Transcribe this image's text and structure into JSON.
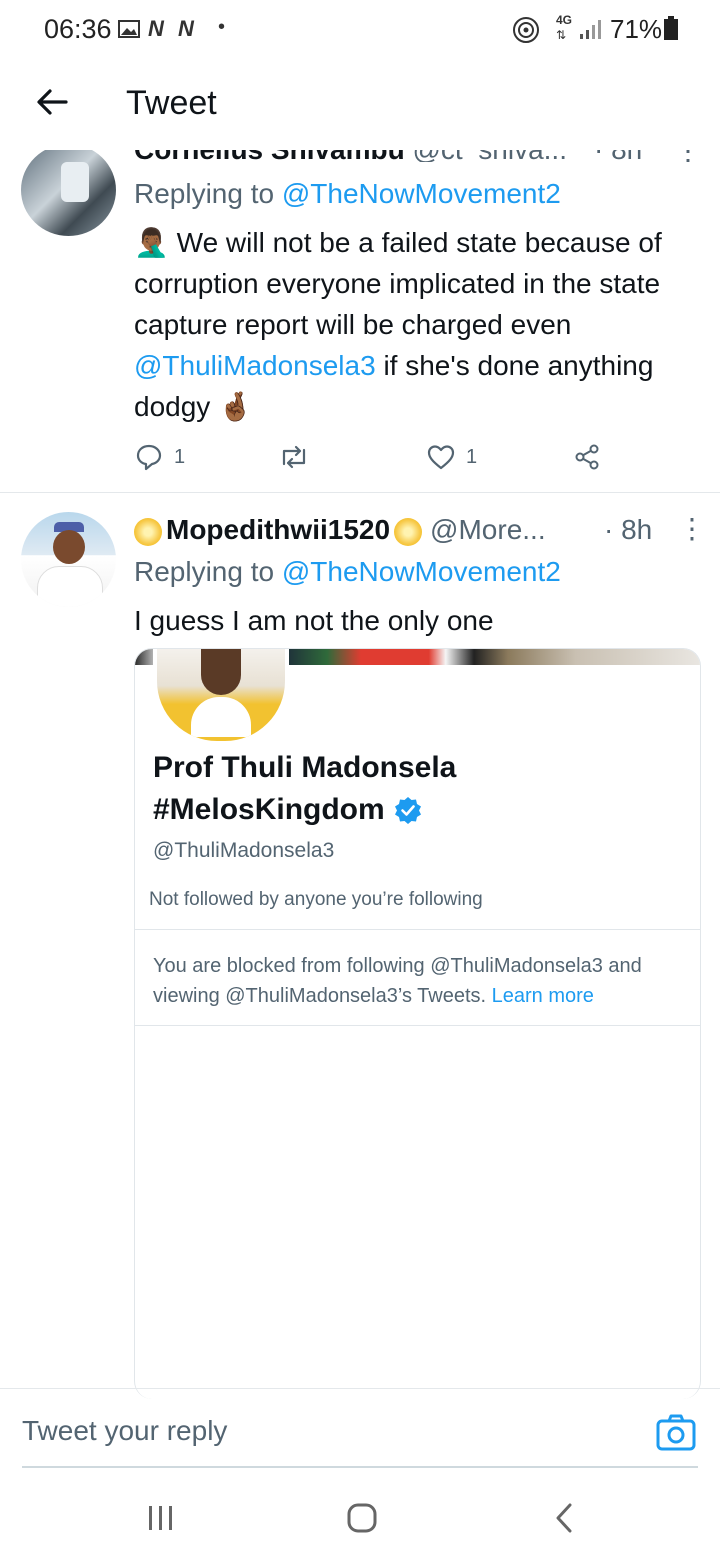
{
  "status_bar": {
    "time": "06:36",
    "network": "4G",
    "battery": "71%"
  },
  "header": {
    "title": "Tweet"
  },
  "tweets": [
    {
      "author_name": "Cornelius Shivambu",
      "handle": "@ct_shiva...",
      "time": "· 8h",
      "replying_prefix": "Replying to ",
      "replying_handle": "@TheNowMovement2",
      "text_emoji": "🤦🏾‍♂️",
      "text_part1": "We will not be a failed state because of corruption everyone implicated in the state capture report will be charged even",
      "text_mention": "@ThuliMadonsela3",
      "text_part2": "if she's done anything dodgy",
      "text_end_emoji": "🤞🏾",
      "reply_count": "1",
      "like_count": "1"
    },
    {
      "author_name": "Mopedithwii1520",
      "handle": "@More...",
      "time": "· 8h",
      "replying_prefix": "Replying to ",
      "replying_handle": "@TheNowMovement2",
      "text": "I guess I am not the only one"
    }
  ],
  "embedded_profile": {
    "name_line1": "Prof Thuli Madonsela",
    "name_line2": "#MelosKingdom",
    "handle": "@ThuliMadonsela3",
    "follow_info": "Not followed by anyone you’re following",
    "blocked_text": "You are blocked from following @ThuliMadonsela3 and viewing @ThuliMadonsela3’s Tweets.",
    "learn_more": "Learn more",
    "verified_color": "#1d9bf0"
  },
  "reply_bar": {
    "placeholder": "Tweet your reply"
  },
  "colors": {
    "accent": "#1d9bf0",
    "text": "#0f1419",
    "muted": "#536471"
  }
}
